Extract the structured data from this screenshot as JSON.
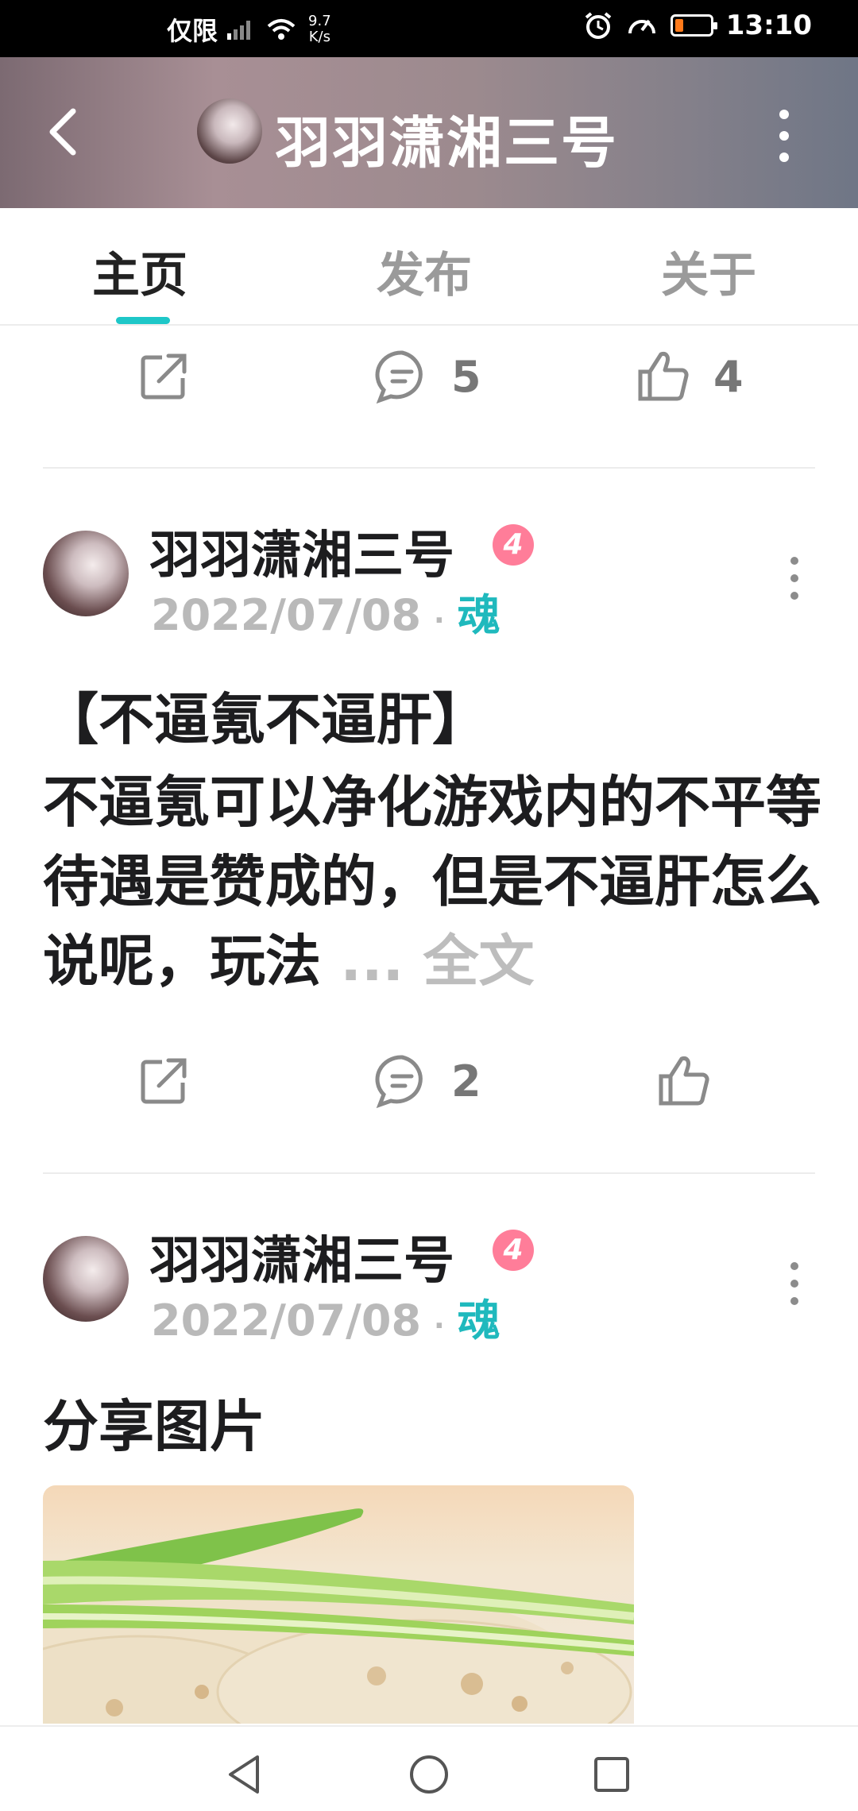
{
  "status_bar": {
    "carrier": "仅限",
    "net_speed_value": "9.7",
    "net_speed_unit": "K/s",
    "time": "13:10"
  },
  "header": {
    "title": "羽羽潇湘三号"
  },
  "tabs": [
    {
      "label": "主页",
      "active": true
    },
    {
      "label": "发布",
      "active": false
    },
    {
      "label": "关于",
      "active": false
    }
  ],
  "top_actions": {
    "comments": "5",
    "likes": "4"
  },
  "posts": [
    {
      "author": "羽羽潇湘三号",
      "level": "4",
      "date": "2022/07/08",
      "separator": "·",
      "tag": "魂",
      "title": "【不逼氪不逼肝】",
      "body": "不逼氪可以净化游戏内的不平等待遇是赞成的，但是不逼肝怎么说呢，玩法 ",
      "ellipsis": "... ",
      "fulltext": "全文",
      "comments": "2",
      "likes": ""
    },
    {
      "author": "羽羽潇湘三号",
      "level": "4",
      "date": "2022/07/08",
      "separator": "·",
      "tag": "魂",
      "text": "分享图片"
    }
  ],
  "colors": {
    "accent": "#1ec7c8",
    "tag": "#1fb9bd",
    "badge": "#ff7d99",
    "battery_low": "#ff7a1a"
  },
  "icons": [
    "back-icon",
    "more-vertical-icon",
    "share-icon",
    "comment-icon",
    "like-icon",
    "nav-back-icon",
    "nav-home-icon",
    "nav-recents-icon"
  ]
}
